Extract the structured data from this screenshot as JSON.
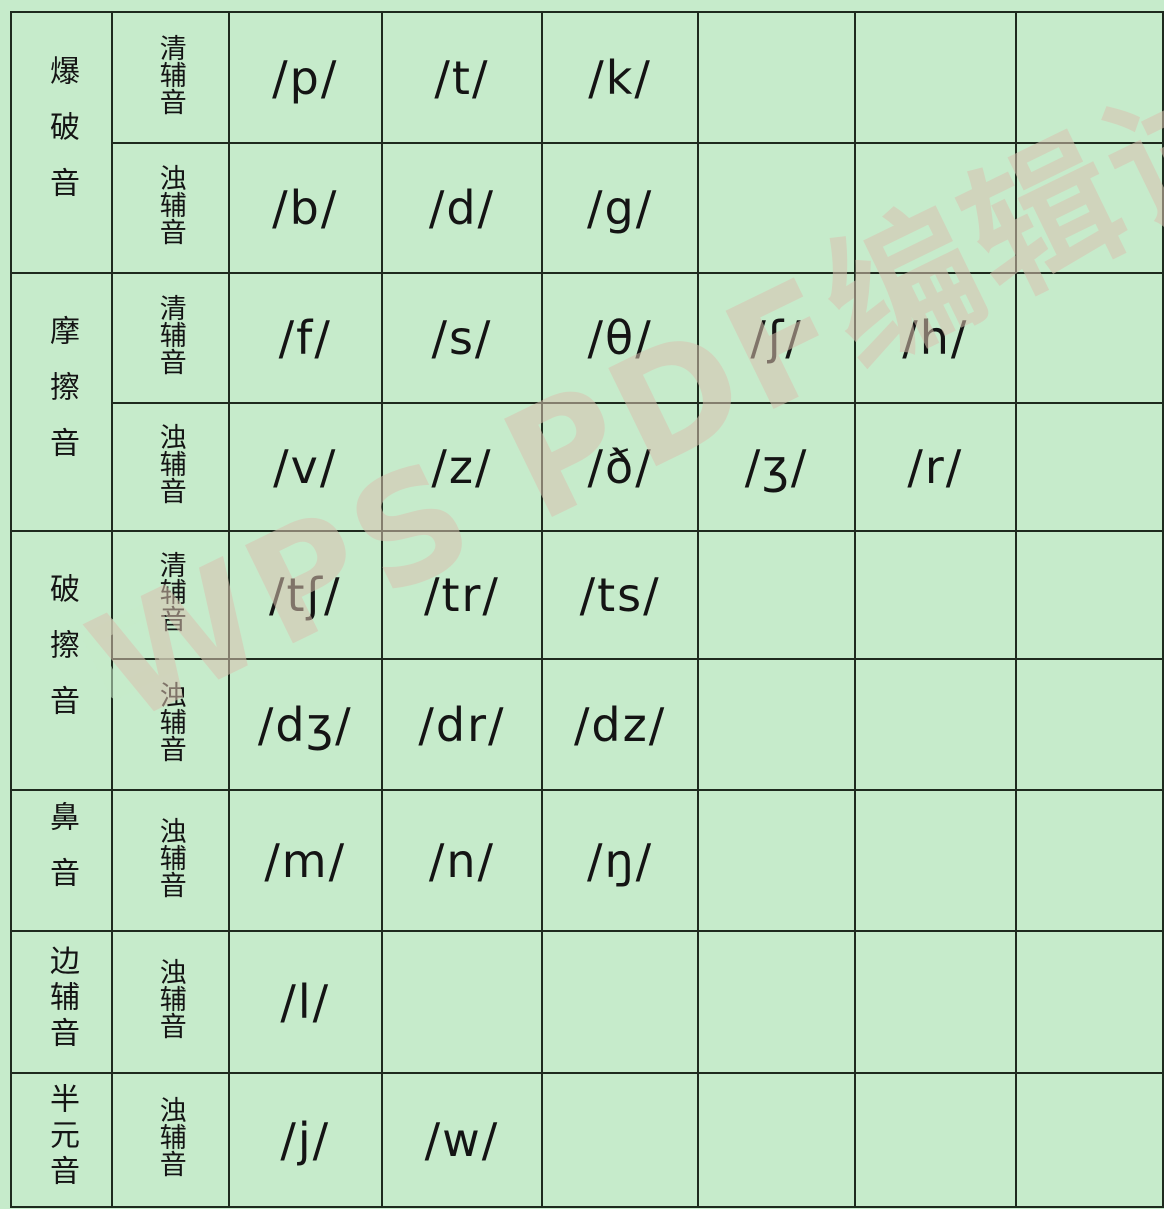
{
  "watermark": "WPS PDF编辑试用",
  "rows": [
    {
      "category": "爆破音",
      "subtype": "清辅音",
      "phonemes": [
        "/p/",
        "/t/",
        "/k/",
        "",
        "",
        ""
      ]
    },
    {
      "category": "",
      "subtype": "浊辅音",
      "phonemes": [
        "/b/",
        "/d/",
        "/g/",
        "",
        "",
        ""
      ]
    },
    {
      "category": "摩擦音",
      "subtype": "清辅音",
      "phonemes": [
        "/f/",
        "/s/",
        "/θ/",
        "/ʃ/",
        "/h/",
        ""
      ]
    },
    {
      "category": "",
      "subtype": "浊辅音",
      "phonemes": [
        "/v/",
        "/z/",
        "/ð/",
        "/ʒ/",
        "/r/",
        ""
      ]
    },
    {
      "category": "破擦音",
      "subtype": "清辅音",
      "phonemes": [
        "/tʃ/",
        "/tr/",
        "/ts/",
        "",
        "",
        ""
      ]
    },
    {
      "category": "",
      "subtype": "浊辅音",
      "phonemes": [
        "/dʒ/",
        "/dr/",
        "/dz/",
        "",
        "",
        ""
      ]
    },
    {
      "category": "鼻音",
      "subtype": "浊辅音",
      "phonemes": [
        "/m/",
        "/n/",
        "/ŋ/",
        "",
        "",
        ""
      ]
    },
    {
      "category": "边辅音",
      "subtype": "浊辅音",
      "phonemes": [
        "/l/",
        "",
        "",
        "",
        "",
        ""
      ]
    },
    {
      "category": "半元音",
      "subtype": "浊辅音",
      "phonemes": [
        "/j/",
        "/w/",
        "",
        "",
        "",
        ""
      ]
    }
  ]
}
